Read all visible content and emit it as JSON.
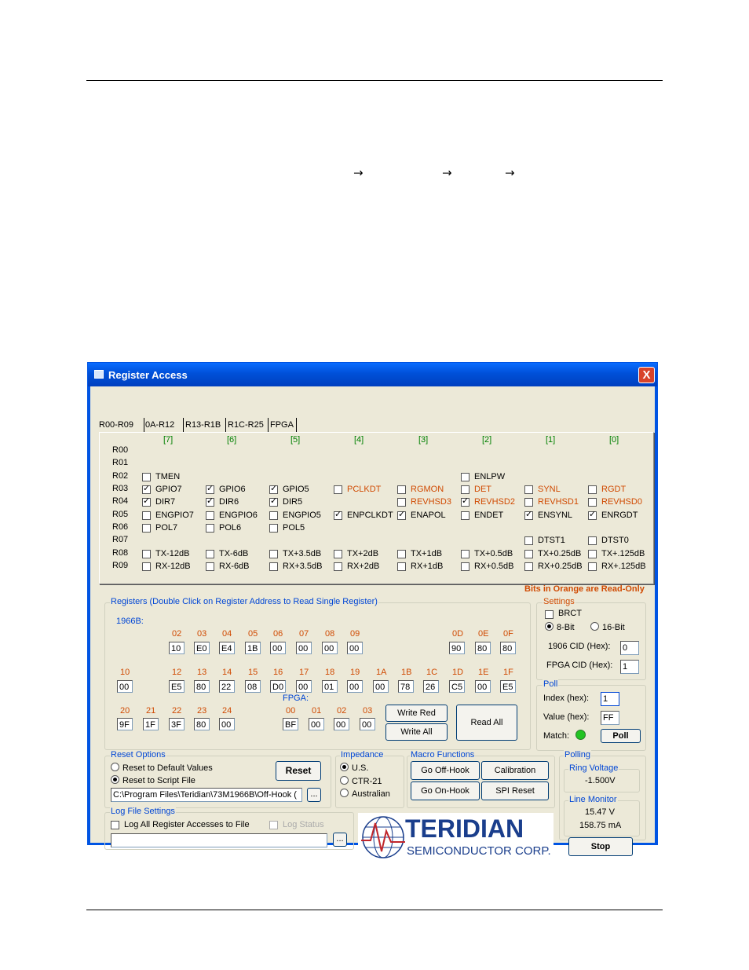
{
  "window": {
    "title": "Register Access",
    "close": "X"
  },
  "arrows": [
    "→",
    "→",
    "→"
  ],
  "tabs": [
    "R00-R09",
    "0A-R12",
    "R13-R1B",
    "R1C-R25",
    "FPGA"
  ],
  "bit_headers": [
    "[7]",
    "[6]",
    "[5]",
    "[4]",
    "[3]",
    "[2]",
    "[1]",
    "[0]"
  ],
  "row_labels": [
    "R00",
    "R01",
    "R02",
    "R03",
    "R04",
    "R05",
    "R06",
    "R07",
    "R08",
    "R09"
  ],
  "bits": {
    "r02": [
      {
        "label": "TMEN",
        "checked": false,
        "ro": false
      },
      {
        "label": "ENLPW",
        "checked": false,
        "ro": false
      }
    ],
    "r03": [
      {
        "label": "GPIO7",
        "checked": true,
        "ro": false
      },
      {
        "label": "GPIO6",
        "checked": true,
        "ro": false
      },
      {
        "label": "GPIO5",
        "checked": true,
        "ro": false
      },
      {
        "label": "PCLKDT",
        "checked": false,
        "ro": true
      },
      {
        "label": "RGMON",
        "checked": false,
        "ro": true
      },
      {
        "label": "DET",
        "checked": false,
        "ro": true
      },
      {
        "label": "SYNL",
        "checked": false,
        "ro": true
      },
      {
        "label": "RGDT",
        "checked": false,
        "ro": true
      }
    ],
    "r04": [
      {
        "label": "DIR7",
        "checked": true,
        "ro": false
      },
      {
        "label": "DIR6",
        "checked": true,
        "ro": false
      },
      {
        "label": "DIR5",
        "checked": true,
        "ro": false
      },
      {
        "label": "REVHSD3",
        "checked": false,
        "ro": true
      },
      {
        "label": "REVHSD2",
        "checked": true,
        "ro": true
      },
      {
        "label": "REVHSD1",
        "checked": false,
        "ro": true
      },
      {
        "label": "REVHSD0",
        "checked": false,
        "ro": true
      }
    ],
    "r05": [
      {
        "label": "ENGPIO7",
        "checked": false,
        "ro": false
      },
      {
        "label": "ENGPIO6",
        "checked": false,
        "ro": false
      },
      {
        "label": "ENGPIO5",
        "checked": false,
        "ro": false
      },
      {
        "label": "ENPCLKDT",
        "checked": true,
        "ro": false
      },
      {
        "label": "ENAPOL",
        "checked": true,
        "ro": false
      },
      {
        "label": "ENDET",
        "checked": false,
        "ro": false
      },
      {
        "label": "ENSYNL",
        "checked": true,
        "ro": false
      },
      {
        "label": "ENRGDT",
        "checked": true,
        "ro": false
      }
    ],
    "r06": [
      {
        "label": "POL7",
        "checked": false,
        "ro": false
      },
      {
        "label": "POL6",
        "checked": false,
        "ro": false
      },
      {
        "label": "POL5",
        "checked": false,
        "ro": false
      }
    ],
    "r07": [
      {
        "label": "DTST1",
        "checked": false,
        "ro": false
      },
      {
        "label": "DTST0",
        "checked": false,
        "ro": false
      }
    ],
    "r08": [
      {
        "label": "TX-12dB",
        "checked": false,
        "ro": false
      },
      {
        "label": "TX-6dB",
        "checked": false,
        "ro": false
      },
      {
        "label": "TX+3.5dB",
        "checked": false,
        "ro": false
      },
      {
        "label": "TX+2dB",
        "checked": false,
        "ro": false
      },
      {
        "label": "TX+1dB",
        "checked": false,
        "ro": false
      },
      {
        "label": "TX+0.5dB",
        "checked": false,
        "ro": false
      },
      {
        "label": "TX+0.25dB",
        "checked": false,
        "ro": false
      },
      {
        "label": "TX+.125dB",
        "checked": false,
        "ro": false
      }
    ],
    "r09": [
      {
        "label": "RX-12dB",
        "checked": false,
        "ro": false
      },
      {
        "label": "RX-6dB",
        "checked": false,
        "ro": false
      },
      {
        "label": "RX+3.5dB",
        "checked": false,
        "ro": false
      },
      {
        "label": "RX+2dB",
        "checked": false,
        "ro": false
      },
      {
        "label": "RX+1dB",
        "checked": false,
        "ro": false
      },
      {
        "label": "RX+0.5dB",
        "checked": false,
        "ro": false
      },
      {
        "label": "RX+0.25dB",
        "checked": false,
        "ro": false
      },
      {
        "label": "RX+.125dB",
        "checked": false,
        "ro": false
      }
    ]
  },
  "readonly_note": "Bits in Orange are Read-Only",
  "registers": {
    "title": "Registers (Double Click on Register Address to Read Single Register)",
    "chip_label": "1966B:",
    "fpga_label": "FPGA:",
    "row1": [
      {
        "addr": "02",
        "val": "10"
      },
      {
        "addr": "03",
        "val": "E0"
      },
      {
        "addr": "04",
        "val": "E4"
      },
      {
        "addr": "05",
        "val": "1B"
      },
      {
        "addr": "06",
        "val": "00"
      },
      {
        "addr": "07",
        "val": "00"
      },
      {
        "addr": "08",
        "val": "00"
      },
      {
        "addr": "09",
        "val": "00"
      },
      {
        "addr": "0D",
        "val": "90"
      },
      {
        "addr": "0E",
        "val": "80"
      },
      {
        "addr": "0F",
        "val": "80"
      }
    ],
    "row2": [
      {
        "addr": "10",
        "val": "00"
      },
      {
        "addr": "12",
        "val": "E5"
      },
      {
        "addr": "13",
        "val": "80"
      },
      {
        "addr": "14",
        "val": "22"
      },
      {
        "addr": "15",
        "val": "08"
      },
      {
        "addr": "16",
        "val": "D0"
      },
      {
        "addr": "17",
        "val": "00"
      },
      {
        "addr": "18",
        "val": "01"
      },
      {
        "addr": "19",
        "val": "00"
      },
      {
        "addr": "1A",
        "val": "00"
      },
      {
        "addr": "1B",
        "val": "78"
      },
      {
        "addr": "1C",
        "val": "26"
      },
      {
        "addr": "1D",
        "val": "C5"
      },
      {
        "addr": "1E",
        "val": "00"
      },
      {
        "addr": "1F",
        "val": "E5"
      }
    ],
    "row3": [
      {
        "addr": "20",
        "val": "9F"
      },
      {
        "addr": "21",
        "val": "1F"
      },
      {
        "addr": "22",
        "val": "3F"
      },
      {
        "addr": "23",
        "val": "80"
      },
      {
        "addr": "24",
        "val": "00"
      }
    ],
    "fpga": [
      {
        "addr": "00",
        "val": "BF"
      },
      {
        "addr": "01",
        "val": "00"
      },
      {
        "addr": "02",
        "val": "00"
      },
      {
        "addr": "03",
        "val": "00"
      }
    ],
    "write_red": "Write Red",
    "write_all": "Write All",
    "read_all": "Read All"
  },
  "settings": {
    "title": "Settings",
    "brct": "BRCT",
    "bit8": "8-Bit",
    "bit16": "16-Bit",
    "cid1906_label": "1906 CID (Hex):",
    "cid1906_val": "0",
    "fpga_cid_label": "FPGA CID (Hex):",
    "fpga_cid_val": "1"
  },
  "poll": {
    "title": "Poll",
    "index_label": "Index (hex):",
    "index_val": "1",
    "value_label": "Value (hex):",
    "value_val": "FF",
    "match_label": "Match:",
    "match_color": "#22c322",
    "button": "Poll"
  },
  "reset_options": {
    "title": "Reset Options",
    "default": "Reset to Default Values",
    "script": "Reset to Script File",
    "button": "Reset",
    "path": "C:\\Program Files\\Teridian\\73M1966B\\Off-Hook (",
    "browse": "..."
  },
  "impedance": {
    "title": "Impedance",
    "opts": [
      "U.S.",
      "CTR-21",
      "Australian"
    ]
  },
  "macro": {
    "title": "Macro Functions",
    "off_hook": "Go Off-Hook",
    "on_hook": "Go On-Hook",
    "calibration": "Calibration",
    "spi_reset": "SPI Reset"
  },
  "polling": {
    "title": "Polling",
    "ring_title": "Ring Voltage",
    "ring_val": "-1.500V",
    "line_title": "Line Monitor",
    "line_v": "15.47 V",
    "line_ma": "158.75 mA",
    "stop": "Stop"
  },
  "log": {
    "title": "Log File Settings",
    "log_all": "Log All Register Accesses to File",
    "log_status": "Log Status",
    "browse": "..."
  },
  "logo": {
    "name": "TERIDIAN",
    "sub": "SEMICONDUCTOR CORP.",
    "color": "#1a3e8c",
    "accent": "#c0262c"
  }
}
